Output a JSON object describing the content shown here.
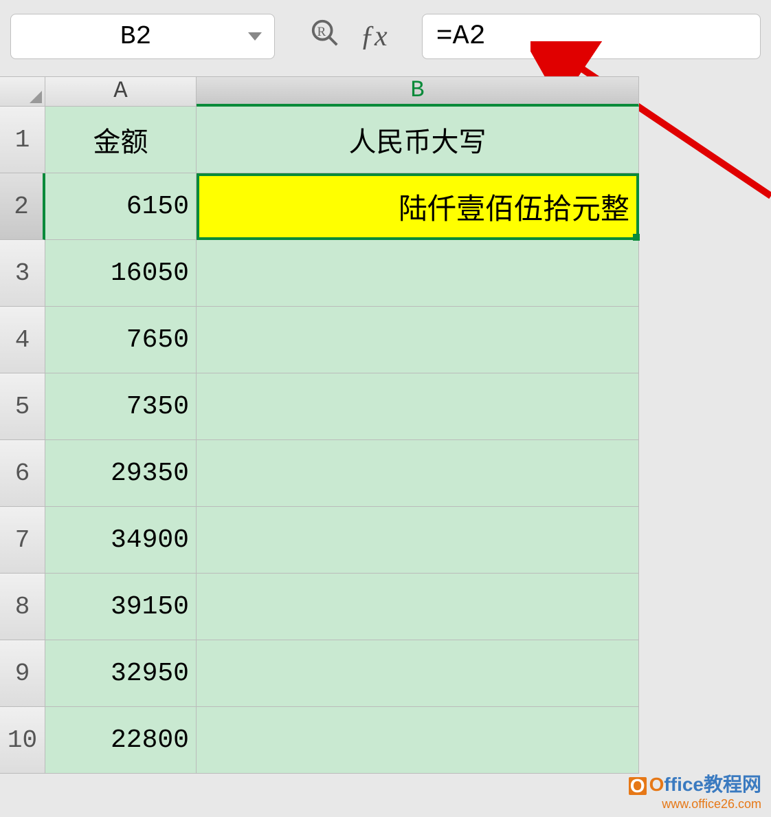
{
  "toolbar": {
    "name_box": "B2",
    "formula": "=A2"
  },
  "columns": [
    "A",
    "B"
  ],
  "headers": {
    "col_a": "金额",
    "col_b": "人民币大写"
  },
  "rows": [
    {
      "n": "1"
    },
    {
      "n": "2",
      "a": "6150",
      "b": "陆仟壹佰伍拾元整"
    },
    {
      "n": "3",
      "a": "16050",
      "b": ""
    },
    {
      "n": "4",
      "a": "7650",
      "b": ""
    },
    {
      "n": "5",
      "a": "7350",
      "b": ""
    },
    {
      "n": "6",
      "a": "29350",
      "b": ""
    },
    {
      "n": "7",
      "a": "34900",
      "b": ""
    },
    {
      "n": "8",
      "a": "39150",
      "b": ""
    },
    {
      "n": "9",
      "a": "32950",
      "b": ""
    },
    {
      "n": "10",
      "a": "22800",
      "b": ""
    }
  ],
  "watermark": {
    "brand_o": "O",
    "brand_rest": "ffice教程网",
    "url": "www.office26.com"
  }
}
